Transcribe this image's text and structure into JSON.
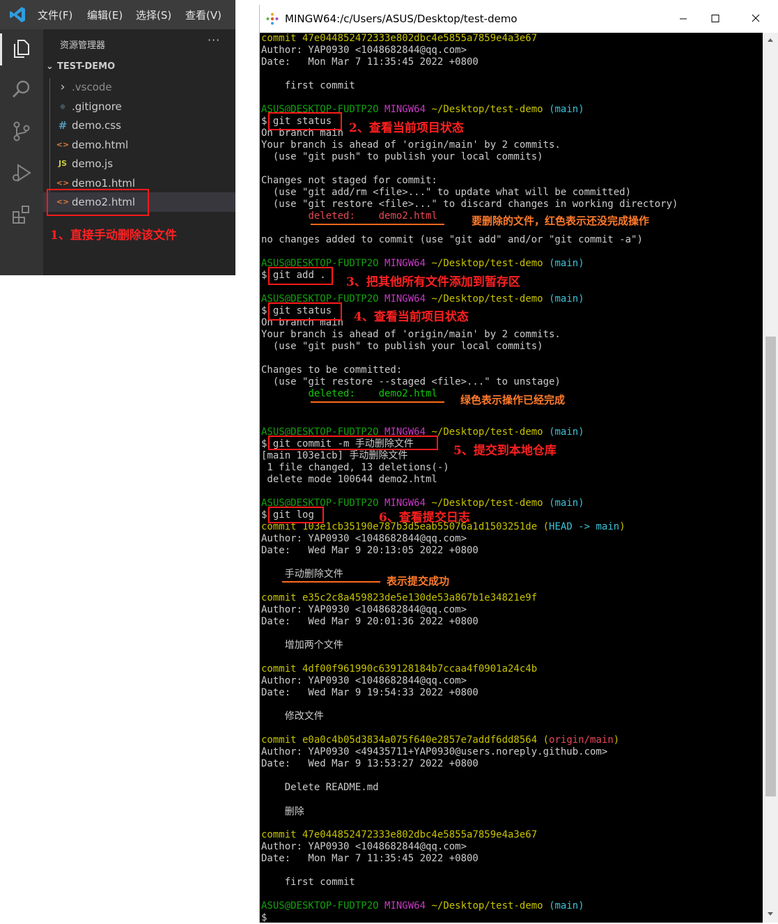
{
  "vscode": {
    "menu": [
      "文件(F)",
      "编辑(E)",
      "选择(S)",
      "查看(V)"
    ],
    "explorer_title": "资源管理器",
    "more_label": "···",
    "folder_name": "TEST-DEMO",
    "files": [
      ".vscode",
      ".gitignore",
      "demo.css",
      "demo.html",
      "demo.js",
      "demo1.html",
      "demo2.html"
    ],
    "selected_file": "demo2.html",
    "icon_glyphs": {
      "chevron": "›",
      "html": "<>",
      "css": "#",
      "js": "JS",
      "git": "◆"
    }
  },
  "annotations": {
    "a1": "1、直接手动删除该文件",
    "a2": "2、查看当前项目状态",
    "a_red_note": "要删除的文件，红色表示还没完成操作",
    "a3": "3、把其他所有文件添加到暂存区",
    "a4": "4、查看当前项目状态",
    "a_green_note": "绿色表示操作已经完成",
    "a5": "5、提交到本地仓库",
    "a6": "6、查看提交日志",
    "a_success": "表示提交成功"
  },
  "terminal": {
    "title": "MINGW64:/c/Users/ASUS/Desktop/test-demo",
    "prompt": {
      "user": "ASUS@DESKTOP-FUDTP2O",
      "shell": "MINGW64",
      "path": "~/Desktop/test-demo",
      "branch": "(main)",
      "dollar": "$"
    },
    "lines": {
      "l1_commit": "commit 47e044852472333e802dbc4e5855a7859e4a3e67",
      "l1_author": "Author: YAP0930 <1048682844@qq.com>",
      "l1_date": "Date:   Mon Mar 7 11:35:45 2022 +0800",
      "l1_msg": "    first commit",
      "cmd_status1": "git status",
      "on_branch1": "On branch main",
      "ahead1": "Your branch is ahead of 'origin/main' by 2 commits.",
      "push_hint1": "  (use \"git push\" to publish your local commits)",
      "not_staged": "Changes not staged for commit:",
      "hint_add": "  (use \"git add/rm <file>...\" to update what will be committed)",
      "hint_restore": "  (use \"git restore <file>...\" to discard changes in working directory)",
      "deleted_label": "deleted:",
      "deleted_file": "demo2.html",
      "no_changes": "no changes added to commit (use \"git add\" and/or \"git commit -a\")",
      "cmd_add": "git add .",
      "cmd_status2": "git status",
      "on_branch2": "On branch main",
      "ahead2": "Your branch is ahead of 'origin/main' by 2 commits.",
      "push_hint2": "  (use \"git push\" to publish your local commits)",
      "to_be_committed": "Changes to be committed:",
      "hint_unstage": "  (use \"git restore --staged <file>...\" to unstage)",
      "cmd_commit": "git commit -m 手动删除文件",
      "commit_out1": "[main 103e1cb] 手动删除文件",
      "commit_out2": " 1 file changed, 13 deletions(-)",
      "commit_out3": " delete mode 100644 demo2.html",
      "cmd_log": "git log",
      "log1_commit": "commit 103e1cb35190e787b3d5eab55076a1d1503251de",
      "log1_head": "HEAD -> main",
      "log1_author": "Author: YAP0930 <1048682844@qq.com>",
      "log1_date": "Date:   Wed Mar 9 20:13:05 2022 +0800",
      "log1_msg": "    手动删除文件",
      "log2_commit": "commit e35c2c8a459823de5e130de53a867b1e34821e9f",
      "log2_author": "Author: YAP0930 <1048682844@qq.com>",
      "log2_date": "Date:   Wed Mar 9 20:01:36 2022 +0800",
      "log2_msg": "    增加两个文件",
      "log3_commit": "commit 4df00f961990c639128184b7ccaa4f0901a24c4b",
      "log3_author": "Author: YAP0930 <1048682844@qq.com>",
      "log3_date": "Date:   Wed Mar 9 19:54:33 2022 +0800",
      "log3_msg": "    修改文件",
      "log4_commit": "commit e0a0c4b05d3834a075f640e2857e7addf6dd8564",
      "log4_ref": "origin/main",
      "log4_author": "Author: YAP0930 <49435711+YAP0930@users.noreply.github.com>",
      "log4_date": "Date:   Wed Mar 9 13:53:27 2022 +0800",
      "log4_msg": "    Delete README.md",
      "log4_msg2": "    删除",
      "log5_commit": "commit 47e044852472333e802dbc4e5855a7859e4a3e67",
      "log5_author": "Author: YAP0930 <1048682844@qq.com>",
      "log5_date": "Date:   Mon Mar 7 11:35:45 2022 +0800",
      "log5_msg": "    first commit"
    }
  },
  "colors": {
    "prompt_user": "#13a10e",
    "prompt_shell": "#c839c5",
    "prompt_path": "#c7c300",
    "branch": "#3bc2d7",
    "deleted_unstaged": "#e74856",
    "deleted_staged": "#16c60c",
    "annotation_red": "#ff2020",
    "annotation_orange": "#ff7b2c"
  }
}
